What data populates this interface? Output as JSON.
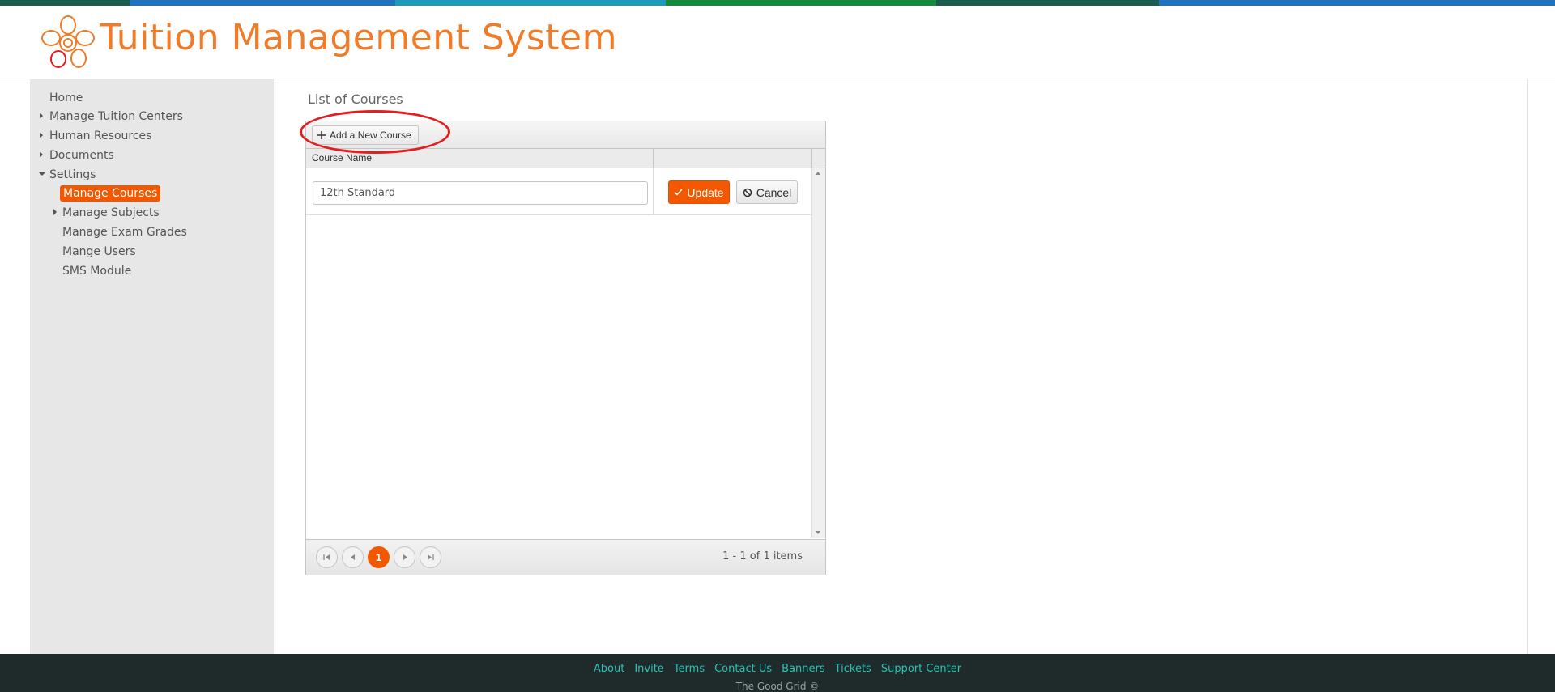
{
  "colors": {
    "accent": "#f35800",
    "title": "#f07c2a",
    "stripe": [
      "#1a5c4e",
      "#1e74c0",
      "#1e74c0",
      "#1a9cb8",
      "#138a3e",
      "#1a5c4e",
      "#1e74c0"
    ],
    "footer_bg": "#1f2a2a",
    "footer_link": "#2cc1b6"
  },
  "header": {
    "logo_icon": "flower-logo-icon",
    "title": "Tuition Management System"
  },
  "sidebar": {
    "items": [
      {
        "label": "Home",
        "icon": "none"
      },
      {
        "label": "Manage Tuition Centers",
        "icon": "triangle-right-icon"
      },
      {
        "label": "Human Resources",
        "icon": "triangle-right-icon"
      },
      {
        "label": "Documents",
        "icon": "triangle-right-icon"
      },
      {
        "label": "Settings",
        "icon": "triangle-down-icon"
      }
    ],
    "sub_items": [
      {
        "label": "Manage Courses",
        "active": true
      },
      {
        "label": "Manage Subjects",
        "icon": "triangle-right-icon"
      },
      {
        "label": "Manage Exam Grades"
      },
      {
        "label": "Mange Users"
      },
      {
        "label": "SMS Module"
      }
    ]
  },
  "main": {
    "heading": "List of Courses",
    "toolbar": {
      "add_label": "Add a New Course",
      "add_icon": "plus-icon"
    },
    "columns": [
      "Course Name",
      ""
    ],
    "edit_row": {
      "course_name_value": "12th Standard",
      "update_label": "Update",
      "update_icon": "check-icon",
      "cancel_label": "Cancel",
      "cancel_icon": "cancel-icon"
    },
    "pager": {
      "current_page": "1",
      "info": "1 - 1 of 1 items",
      "icons": [
        "first-page-icon",
        "prev-page-icon",
        "next-page-icon",
        "last-page-icon"
      ]
    }
  },
  "footer": {
    "links": [
      "About",
      "Invite",
      "Terms",
      "Contact Us",
      "Banners",
      "Tickets",
      "Support Center"
    ],
    "copyright": "The Good Grid ©"
  }
}
